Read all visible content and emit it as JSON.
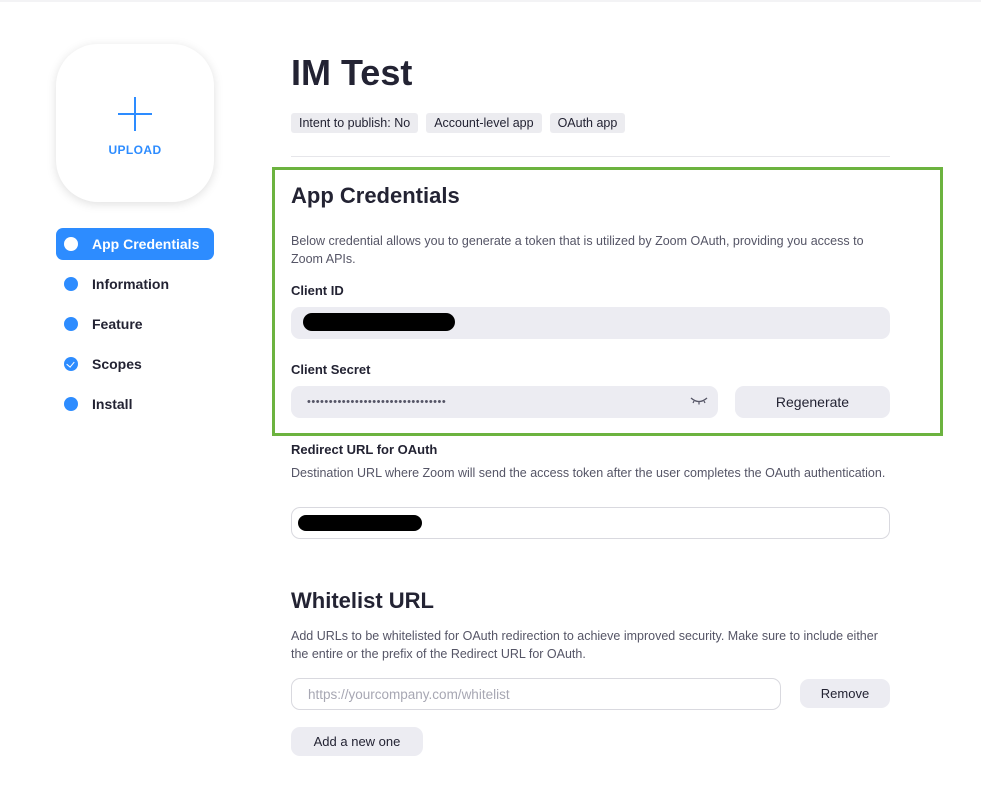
{
  "upload": {
    "label": "UPLOAD"
  },
  "nav": {
    "items": [
      {
        "label": "App Credentials",
        "active": true
      },
      {
        "label": "Information"
      },
      {
        "label": "Feature"
      },
      {
        "label": "Scopes",
        "checked": true
      },
      {
        "label": "Install"
      }
    ]
  },
  "app": {
    "title": "IM Test",
    "badges": [
      "Intent to publish: No",
      "Account-level app",
      "OAuth app"
    ]
  },
  "credentials": {
    "title": "App Credentials",
    "description": "Below credential allows you to generate a token that is utilized by Zoom OAuth, providing you access to Zoom APIs.",
    "client_id_label": "Client ID",
    "client_secret_label": "Client Secret",
    "client_secret_masked": "••••••••••••••••••••••••••••••••",
    "regenerate_label": "Regenerate"
  },
  "redirect": {
    "label": "Redirect URL for OAuth",
    "description": "Destination URL where Zoom will send the access token after the user completes the OAuth authentication."
  },
  "whitelist": {
    "title": "Whitelist URL",
    "description": "Add URLs to be whitelisted for OAuth redirection to achieve improved security. Make sure to include either the entire or the prefix of the Redirect URL for OAuth.",
    "placeholder": "https://yourcompany.com/whitelist",
    "remove_label": "Remove",
    "add_label": "Add a new one"
  },
  "colors": {
    "accent": "#2d8cff",
    "highlight_border": "#6cb33f"
  }
}
